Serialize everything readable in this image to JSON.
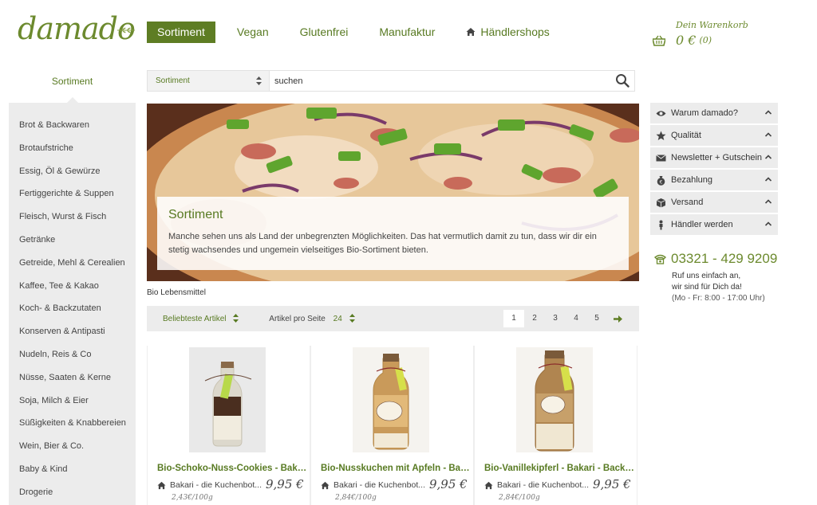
{
  "logo": "damado",
  "nav": [
    {
      "label": "Sortiment"
    },
    {
      "label": "Vegan"
    },
    {
      "label": "Glutenfrei"
    },
    {
      "label": "Manufaktur"
    },
    {
      "label": "Händlershops"
    }
  ],
  "cart": {
    "title": "Dein Warenkorb",
    "amount": "0 €",
    "count": "(0)"
  },
  "sidebar": {
    "title": "Sortiment",
    "items": [
      "Brot & Backwaren",
      "Brotaufstriche",
      "Essig, Öl & Gewürze",
      "Fertiggerichte & Suppen",
      "Fleisch, Wurst & Fisch",
      "Getränke",
      "Getreide, Mehl & Cerealien",
      "Kaffee, Tee & Kakao",
      "Koch- & Backzutaten",
      "Konserven & Antipasti",
      "Nudeln, Reis & Co",
      "Nüsse, Saaten & Kerne",
      "Soja, Milch & Eier",
      "Süßigkeiten & Knabbereien",
      "Wein, Bier & Co.",
      "Baby & Kind",
      "Drogerie"
    ]
  },
  "search": {
    "select": "Sortiment",
    "value": "suchen"
  },
  "hero": {
    "title": "Sortiment",
    "text": "Manche sehen uns als Land der unbegrenzten Möglichkeiten. Das hat vermutlich damit zu tun, dass wir dir ein stetig wachsendes und ungemein vielseitiges Bio-Sortiment bieten."
  },
  "breadcrumb": "Bio Lebensmittel",
  "toolbar": {
    "sort": "Beliebteste Artikel",
    "per_page_label": "Artikel pro Seite",
    "per_page_value": "24",
    "pages": [
      "1",
      "2",
      "3",
      "4",
      "5"
    ]
  },
  "products": [
    {
      "title": "Bio-Schoko-Nuss-Cookies - Bakari - Backmischung",
      "maker": "Bakari - die Kuchenbot...",
      "price": "9,95 €",
      "unit": "2,43€/100g"
    },
    {
      "title": "Bio-Nusskuchen mit Äpfeln - Bakari - Backmischung",
      "maker": "Bakari - die Kuchenbot...",
      "price": "9,95 €",
      "unit": "2,84€/100g"
    },
    {
      "title": "Bio-Vanillekipferl - Bakari - Backmischung",
      "maker": "Bakari - die Kuchenbot...",
      "price": "9,95 €",
      "unit": "2,84€/100g"
    }
  ],
  "info": [
    {
      "label": "Warum damado?",
      "icon": "eye-icon"
    },
    {
      "label": "Qualität",
      "icon": "star-icon"
    },
    {
      "label": "Newsletter + Gutschein",
      "icon": "envelope-icon"
    },
    {
      "label": "Bezahlung",
      "icon": "money-bag-icon"
    },
    {
      "label": "Versand",
      "icon": "box-icon"
    },
    {
      "label": "Händler werden",
      "icon": "person-icon"
    }
  ],
  "contact": {
    "phone": "03321 - 429 9209",
    "line1": "Ruf uns einfach an,",
    "line2": "wir sind für Dich da!",
    "hours": "(Mo - Fr: 8:00 - 17:00 Uhr)"
  },
  "colors": {
    "brand": "#5e7d24",
    "panel": "#ececec"
  }
}
